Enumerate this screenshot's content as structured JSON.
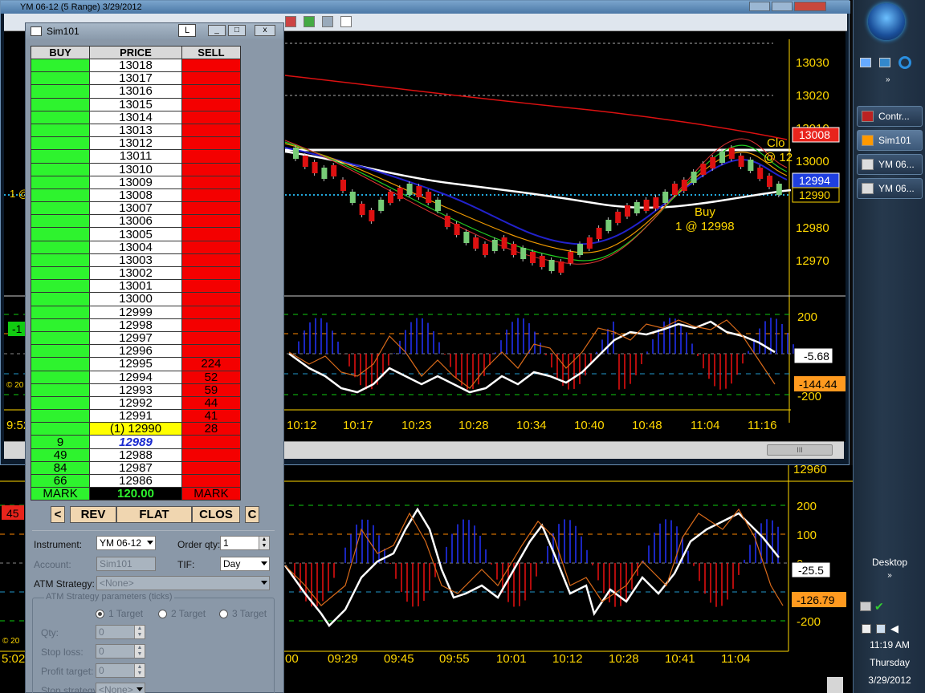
{
  "chart_window": {
    "title": "YM 06-12 (5 Range)  3/29/2012",
    "price_axis": [
      "13030",
      "13020",
      "13010",
      "13000",
      "12990",
      "12980",
      "12970"
    ],
    "price_badges": {
      "red": "13008",
      "blue": "12994",
      "yellow": "12990"
    },
    "annotation_buy": "Buy",
    "annotation_fill": "1 @ 12998",
    "annotation_close": "Clo",
    "annotation_close2": "@ 12",
    "indicator_axis": [
      "200",
      "-200"
    ],
    "indicator_badge_white": "-5.68",
    "indicator_badge_orange": "-144.44",
    "left_partial_labels": [
      "1 @",
      "-1",
      "9:52",
      "© 20"
    ],
    "time_axis": [
      "10:12",
      "10:17",
      "10:23",
      "10:28",
      "10:34",
      "10:40",
      "10:48",
      "11:04",
      "11:16"
    ],
    "scroll_glyph": "III"
  },
  "lower_chart": {
    "indicator_axis": [
      "12960",
      "200",
      "100",
      "0",
      "-200"
    ],
    "badge_white": "-25.5",
    "badge_orange": "-126.79",
    "left_badge": "45",
    "left_partial": [
      "© 20",
      "5:02"
    ],
    "time_axis": [
      "00",
      "09:29",
      "09:45",
      "09:55",
      "10:01",
      "10:12",
      "10:28",
      "10:41",
      "11:04"
    ]
  },
  "dom": {
    "title": "Sim101",
    "lock_button": "L",
    "headers": {
      "buy": "BUY",
      "price": "PRICE",
      "sell": "SELL"
    },
    "rows": [
      {
        "buy": "",
        "price": "13018",
        "sell": ""
      },
      {
        "buy": "",
        "price": "13017",
        "sell": ""
      },
      {
        "buy": "",
        "price": "13016",
        "sell": ""
      },
      {
        "buy": "",
        "price": "13015",
        "sell": ""
      },
      {
        "buy": "",
        "price": "13014",
        "sell": ""
      },
      {
        "buy": "",
        "price": "13013",
        "sell": ""
      },
      {
        "buy": "",
        "price": "13012",
        "sell": ""
      },
      {
        "buy": "",
        "price": "13011",
        "sell": ""
      },
      {
        "buy": "",
        "price": "13010",
        "sell": ""
      },
      {
        "buy": "",
        "price": "13009",
        "sell": ""
      },
      {
        "buy": "",
        "price": "13008",
        "sell": ""
      },
      {
        "buy": "",
        "price": "13007",
        "sell": ""
      },
      {
        "buy": "",
        "price": "13006",
        "sell": ""
      },
      {
        "buy": "",
        "price": "13005",
        "sell": ""
      },
      {
        "buy": "",
        "price": "13004",
        "sell": ""
      },
      {
        "buy": "",
        "price": "13003",
        "sell": ""
      },
      {
        "buy": "",
        "price": "13002",
        "sell": ""
      },
      {
        "buy": "",
        "price": "13001",
        "sell": ""
      },
      {
        "buy": "",
        "price": "13000",
        "sell": ""
      },
      {
        "buy": "",
        "price": "12999",
        "sell": ""
      },
      {
        "buy": "",
        "price": "12998",
        "sell": ""
      },
      {
        "buy": "",
        "price": "12997",
        "sell": ""
      },
      {
        "buy": "",
        "price": "12996",
        "sell": ""
      },
      {
        "buy": "",
        "price": "12995",
        "sell": "224"
      },
      {
        "buy": "",
        "price": "12994",
        "sell": "52"
      },
      {
        "buy": "",
        "price": "12993",
        "sell": "59"
      },
      {
        "buy": "",
        "price": "12992",
        "sell": "44"
      },
      {
        "buy": "",
        "price": "12991",
        "sell": "41"
      },
      {
        "buy": "",
        "price": "(1) 12990",
        "sell": "28",
        "last": true
      },
      {
        "buy": "9",
        "price": "12989",
        "sell": "",
        "bid": true
      },
      {
        "buy": "49",
        "price": "12988",
        "sell": ""
      },
      {
        "buy": "84",
        "price": "12987",
        "sell": ""
      },
      {
        "buy": "66",
        "price": "12986",
        "sell": ""
      }
    ],
    "mark_buy": "MARK",
    "mark_price": "120.00",
    "mark_sell": "MARK",
    "buttons": {
      "left": "<",
      "rev": "REV",
      "flat": "FLAT",
      "close": "CLOS",
      "c": "C"
    },
    "form": {
      "instrument_label": "Instrument:",
      "instrument_value": "YM 06-12",
      "order_qty_label": "Order qty:",
      "order_qty_value": "1",
      "account_label": "Account:",
      "account_value": "Sim101",
      "tif_label": "TIF:",
      "tif_value": "Day",
      "atm_label": "ATM Strategy:",
      "atm_value": "<None>",
      "params_title": "ATM Strategy parameters (ticks)",
      "target1": "1 Target",
      "target2": "2 Target",
      "target3": "3 Target",
      "qty_label": "Qty:",
      "qty_value": "0",
      "stop_loss_label": "Stop loss:",
      "stop_loss_value": "0",
      "profit_target_label": "Profit target:",
      "profit_target_value": "0",
      "stop_strategy_label": "Stop strategy:",
      "stop_strategy_value": "<None>"
    }
  },
  "taskbar": {
    "items": [
      "Contr...",
      "Sim101",
      "YM 06...",
      "YM 06..."
    ],
    "desktop": "Desktop",
    "time": "11:19 AM",
    "day": "Thursday",
    "date": "3/29/2012"
  },
  "colors": {
    "buy_col": "#2ef32e",
    "sell_col": "#f40000",
    "price_axis": "#ffd700",
    "badge_red": "#e8241c",
    "badge_blue": "#1f3fe0",
    "badge_orange": "#ff9a1f"
  }
}
